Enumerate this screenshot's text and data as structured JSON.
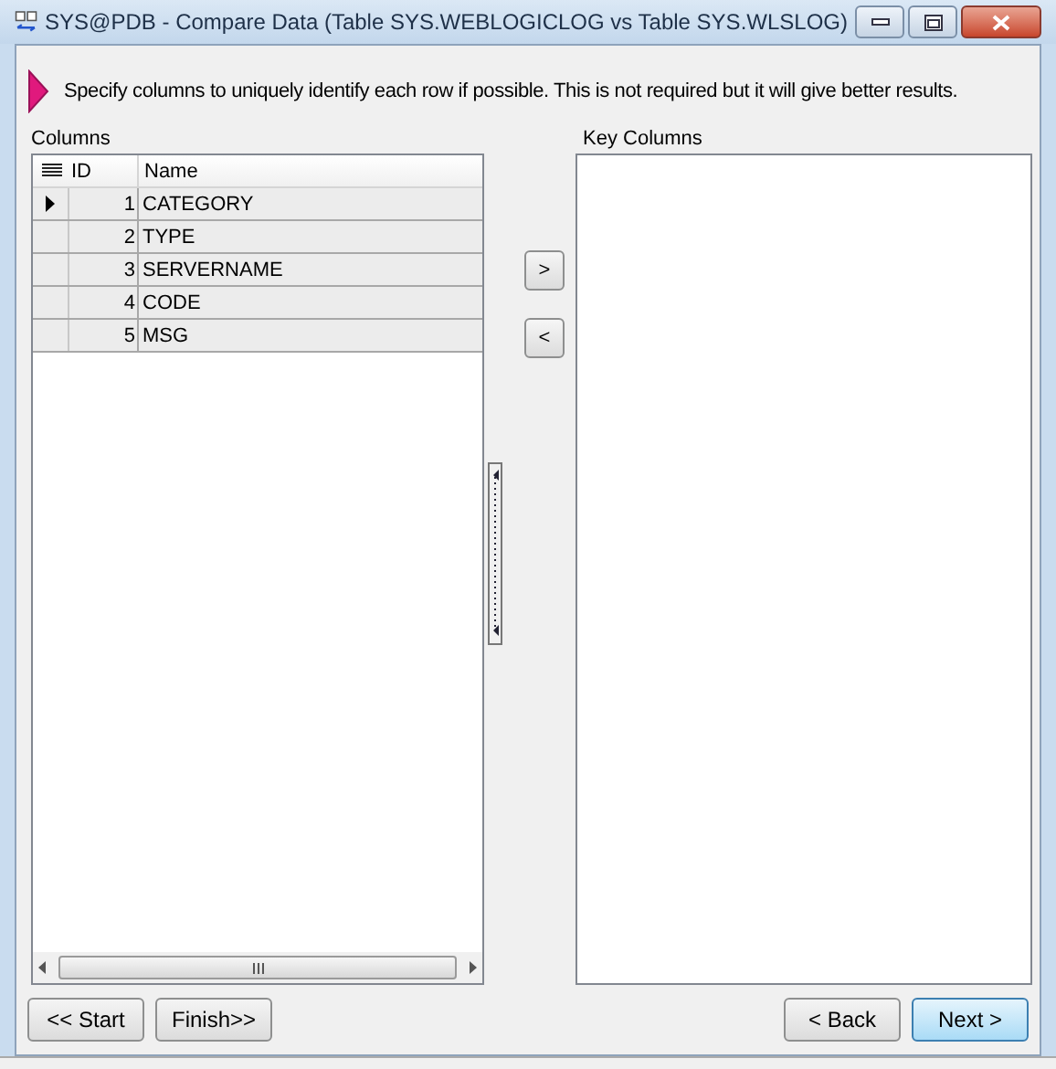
{
  "window": {
    "title": "SYS@PDB - Compare Data (Table SYS.WEBLOGICLOG vs Table SYS.WLSLOG)"
  },
  "instruction": "Specify columns to uniquely identify each row if possible.  This is not required but it will give better results.",
  "columns_panel": {
    "label": "Columns",
    "table": {
      "columns": [
        "ID",
        "Name"
      ],
      "rows": [
        {
          "id": "1",
          "name": "CATEGORY",
          "current": true
        },
        {
          "id": "2",
          "name": "TYPE",
          "current": false
        },
        {
          "id": "3",
          "name": "SERVERNAME",
          "current": false
        },
        {
          "id": "4",
          "name": "CODE",
          "current": false
        },
        {
          "id": "5",
          "name": "MSG",
          "current": false
        }
      ]
    }
  },
  "move_buttons": [
    ">",
    "<"
  ],
  "key_columns_panel": {
    "label": "Key Columns"
  },
  "left_buttons": [
    {
      "label": "<< Start",
      "highlighted": false
    },
    {
      "label": "Finish>>",
      "highlighted": false
    }
  ],
  "right_buttons": [
    {
      "label": "< Back",
      "highlighted": false
    },
    {
      "label": "Next >",
      "highlighted": true
    }
  ]
}
